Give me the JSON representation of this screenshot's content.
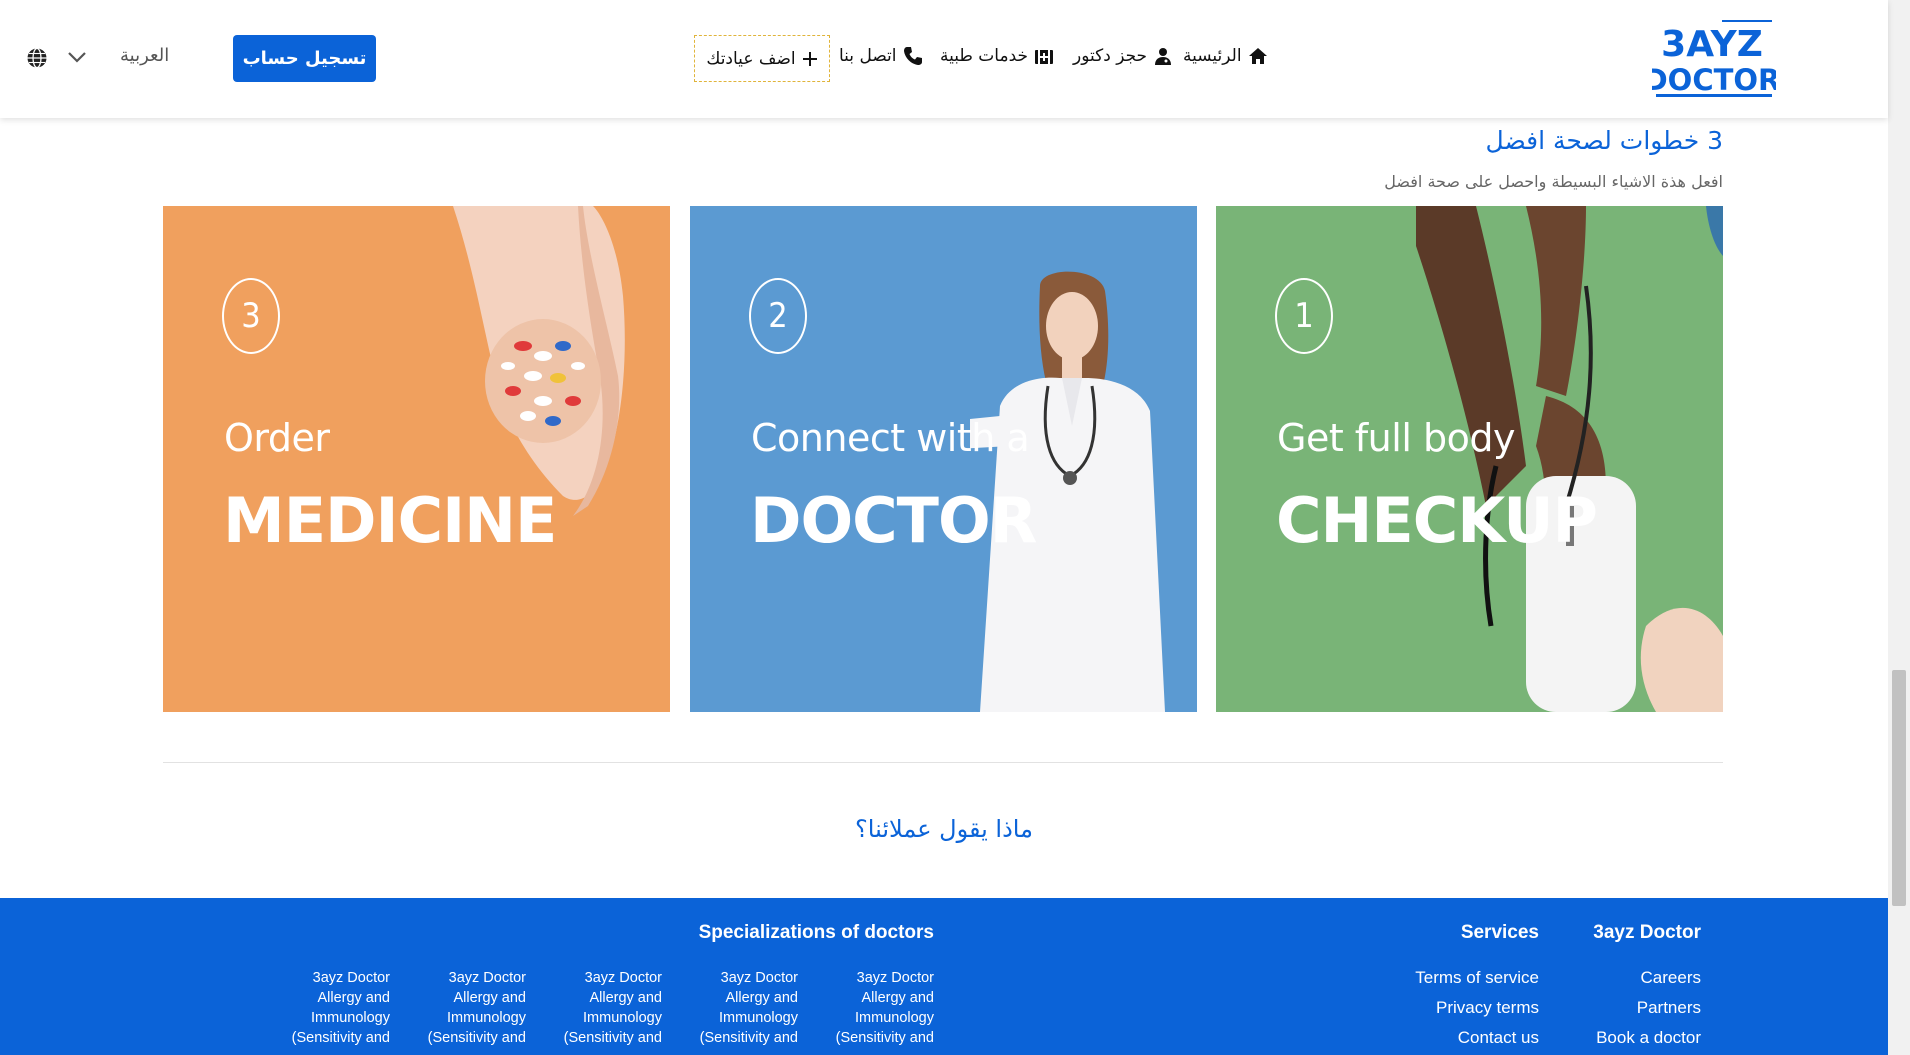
{
  "header": {
    "logo": {
      "line1": "3AYZ",
      "line2": "DOCTOR"
    },
    "nav": {
      "home": "الرئيسية",
      "book_doctor": "حجز دكتور",
      "medical_services": "خدمات طبية",
      "contact": "اتصل بنا"
    },
    "add_clinic": "اضف عيادتك",
    "register": "تسجيل حساب",
    "language": "العربية"
  },
  "steps": {
    "title": "3 خطوات لصحة افضل",
    "subtitle": "افعل هذة الاشياء البسيطة واحصل على صحة افضل",
    "cards": [
      {
        "number": "3",
        "line1": "Order",
        "line2": "MEDICINE"
      },
      {
        "number": "2",
        "line1": "Connect with a",
        "line2": "DOCTOR"
      },
      {
        "number": "1",
        "line1": "Get full body",
        "line2": "CHECKUP"
      }
    ]
  },
  "testimonials": {
    "title": "ماذا يقول عملائنا؟"
  },
  "footer": {
    "brand": {
      "heading": "3ayz Doctor",
      "links": [
        "Careers",
        "Partners",
        "Book a doctor"
      ]
    },
    "services": {
      "heading": "Services",
      "links": [
        "Terms of service",
        "Privacy terms",
        "Contact us"
      ]
    },
    "specializations": {
      "heading": "Specializations of doctors",
      "items": [
        "3ayz Doctor Allergy and Immunology (Sensitivity and",
        "3ayz Doctor Allergy and Immunology (Sensitivity and",
        "3ayz Doctor Allergy and Immunology (Sensitivity and",
        "3ayz Doctor Allergy and Immunology (Sensitivity and",
        "3ayz Doctor Allergy and Immunology (Sensitivity and"
      ]
    }
  },
  "colors": {
    "primary": "#0b63d8",
    "orange": "#f0a05e",
    "blue": "#5b9ad2",
    "green": "#79b477",
    "dashed_border": "#e0b43a"
  },
  "icons": {
    "home": "home-icon",
    "doctor": "user-doctor-icon",
    "services": "medical-kit-icon",
    "phone": "phone-icon",
    "plus": "plus-icon",
    "chevron": "chevron-down-icon",
    "globe": "globe-icon"
  }
}
